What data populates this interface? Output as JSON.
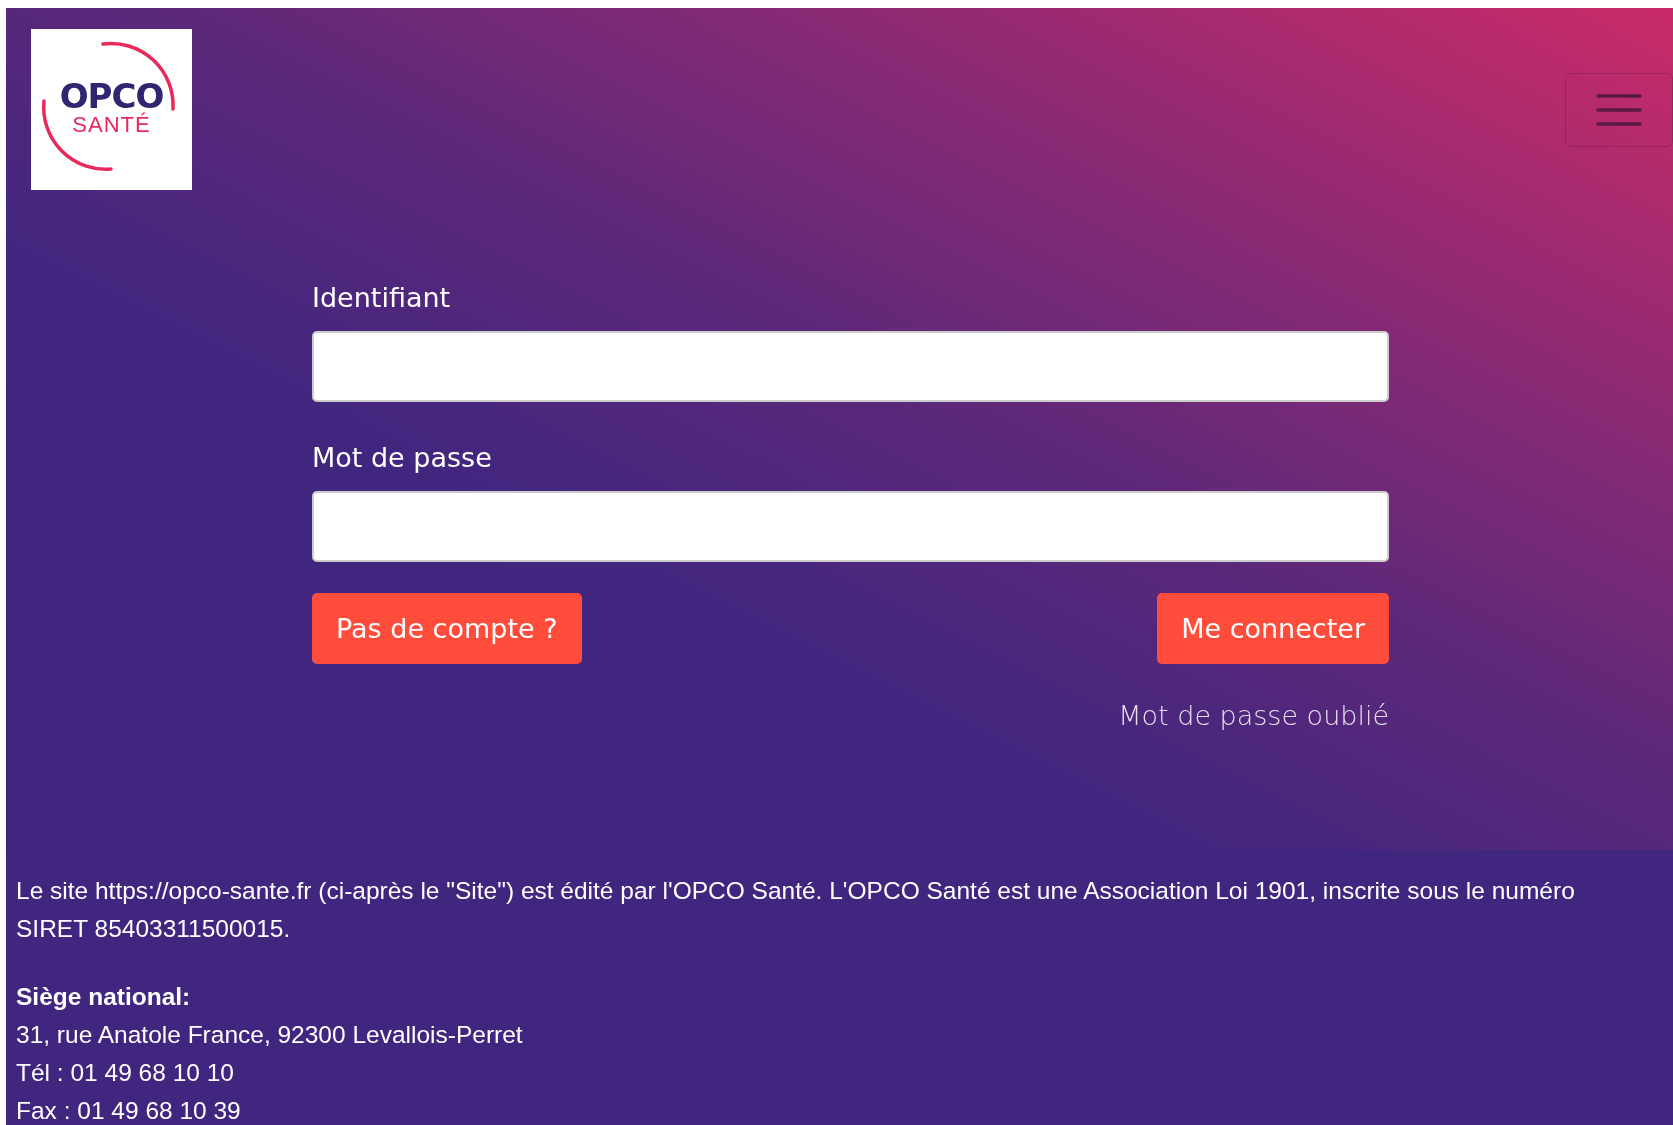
{
  "logo": {
    "line1": "OPCO",
    "line2": "SANTÉ"
  },
  "form": {
    "fields": [
      {
        "label": "Identifiant"
      },
      {
        "label": "Mot de passe"
      }
    ],
    "signup_button": "Pas de compte ?",
    "login_button": "Me connecter",
    "forgot_link": "Mot de passe oublié"
  },
  "footer": {
    "intro": "Le site https://opco-sante.fr (ci-après le \"Site\") est édité par l'OPCO Santé. L'OPCO Santé est une Association Loi 1901, inscrite sous le numéro SIRET 85403311500015.",
    "heading": "Siège national:",
    "lines": [
      "31, rue Anatole France, 92300 Levallois-Perret",
      "Tél : 01 49 68 10 10",
      "Fax : 01 49 68 10 39"
    ]
  }
}
